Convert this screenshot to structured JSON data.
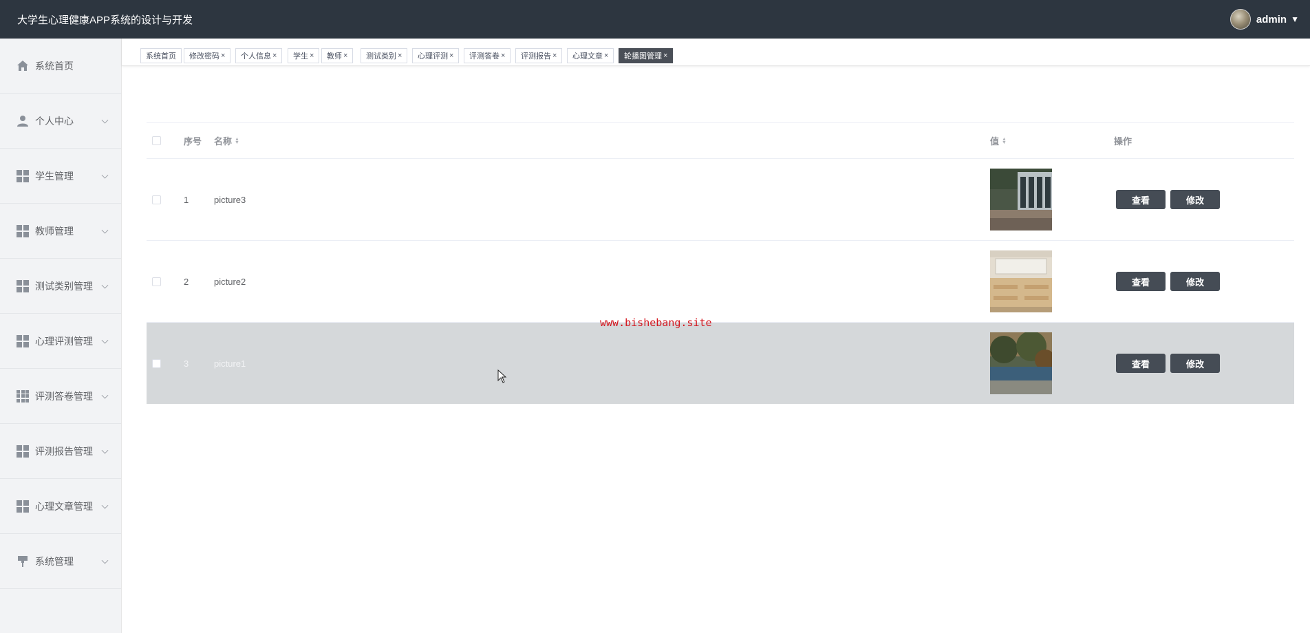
{
  "header": {
    "title": "大学生心理健康APP系统的设计与开发",
    "username": "admin"
  },
  "sidebar": {
    "items": [
      {
        "label": "系统首页",
        "icon": "home-icon",
        "has_submenu": false
      },
      {
        "label": "个人中心",
        "icon": "user-icon",
        "has_submenu": true
      },
      {
        "label": "学生管理",
        "icon": "grid-icon",
        "has_submenu": true
      },
      {
        "label": "教师管理",
        "icon": "grid-icon",
        "has_submenu": true
      },
      {
        "label": "测试类别管理",
        "icon": "grid-icon",
        "has_submenu": true
      },
      {
        "label": "心理评测管理",
        "icon": "grid-icon",
        "has_submenu": true
      },
      {
        "label": "评测答卷管理",
        "icon": "grid9-icon",
        "has_submenu": true
      },
      {
        "label": "评测报告管理",
        "icon": "grid-icon",
        "has_submenu": true
      },
      {
        "label": "心理文章管理",
        "icon": "grid-icon",
        "has_submenu": true
      },
      {
        "label": "系统管理",
        "icon": "paint-roller-icon",
        "has_submenu": true
      }
    ]
  },
  "tabs": [
    {
      "label": "系统首页",
      "closable": false,
      "active": false
    },
    {
      "label": "修改密码",
      "closable": true,
      "active": false
    },
    {
      "label": "个人信息",
      "closable": true,
      "active": false
    },
    {
      "label": "学生",
      "closable": true,
      "active": false
    },
    {
      "label": "教师",
      "closable": true,
      "active": false
    },
    {
      "label": "测试类别",
      "closable": true,
      "active": false
    },
    {
      "label": "心理评测",
      "closable": true,
      "active": false
    },
    {
      "label": "评测答卷",
      "closable": true,
      "active": false
    },
    {
      "label": "评测报告",
      "closable": true,
      "active": false
    },
    {
      "label": "心理文章",
      "closable": true,
      "active": false
    },
    {
      "label": "轮播图管理",
      "closable": true,
      "active": true
    }
  ],
  "tab_close_glyph": "×",
  "table": {
    "columns": {
      "index": "序号",
      "name": "名称",
      "value": "值",
      "actions": "操作"
    },
    "rows": [
      {
        "index": "1",
        "name": "picture3",
        "thumb": "outdoor-building-image"
      },
      {
        "index": "2",
        "name": "picture2",
        "thumb": "classroom-image"
      },
      {
        "index": "3",
        "name": "picture1",
        "thumb": "park-trees-image"
      }
    ],
    "view_label": "查看",
    "edit_label": "修改"
  },
  "watermark": "www.bishebang.site",
  "colors": {
    "topbar": "#2d3640",
    "sidebar": "#f2f3f5",
    "active_tab": "#4a4f57",
    "button": "#454c55",
    "highlight_row": "#d5d8da",
    "watermark": "#d4141c"
  }
}
